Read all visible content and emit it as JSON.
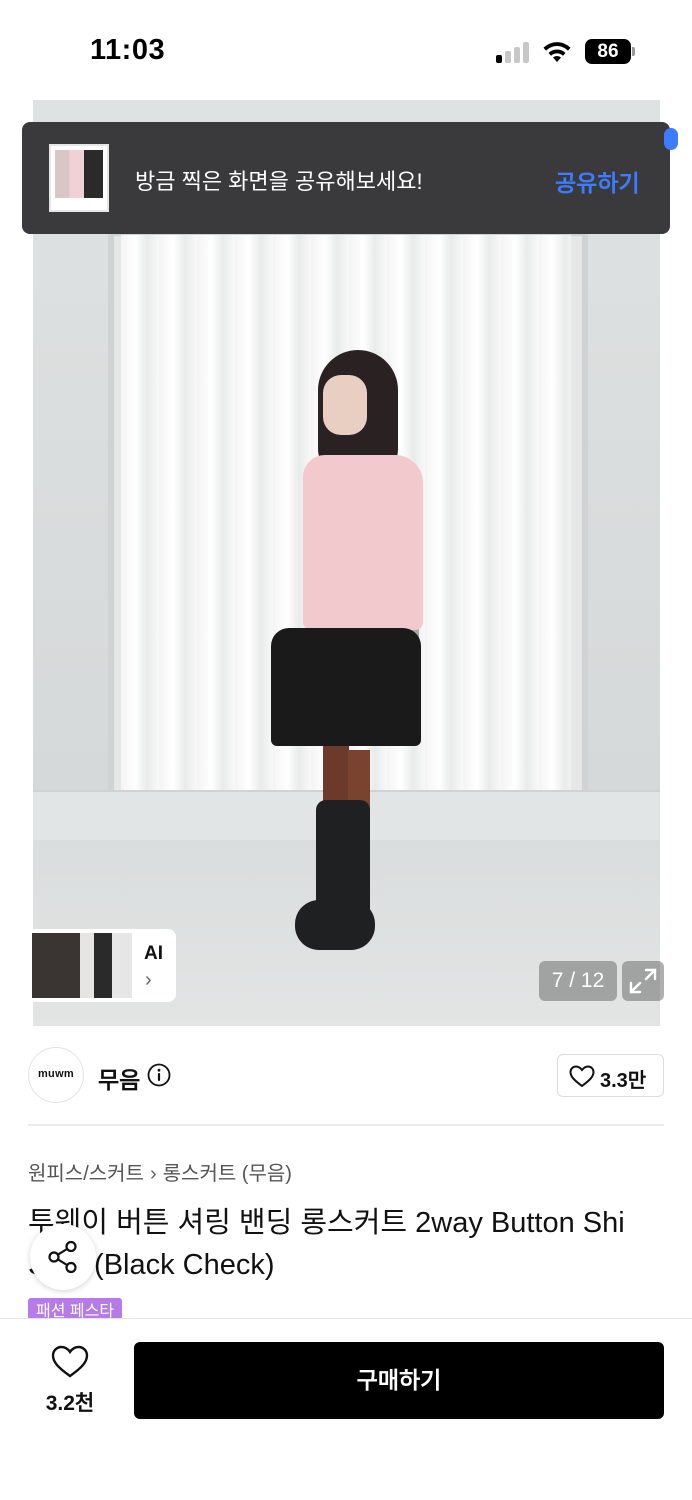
{
  "status_bar": {
    "time": "11:03",
    "battery": "86",
    "signal_bars_active": 1,
    "signal_bars_total": 4
  },
  "toast": {
    "message": "방금 찍은 화면을 공유해보세요!",
    "action_label": "공유하기",
    "action_color": "#3d7bff"
  },
  "gallery": {
    "page_indicator": "7 / 12",
    "current_page": 7,
    "total_pages": 12,
    "ai_label": "AI",
    "ai_chevron": "›",
    "expand_icon": "expand-icon"
  },
  "store": {
    "logo_text": "muwm",
    "name": "무음",
    "like_count": "3.3만"
  },
  "breadcrumb": {
    "category": "원피스/스커트",
    "separator": "›",
    "subcategory": "롱스커트 (무음)"
  },
  "product": {
    "title": "투웨이 버튼 셔링 밴딩 롱스커트 2way Button Shi\n     Skirt (Black Check)",
    "badge": "패션 페스타",
    "badge_color": "#b67be8"
  },
  "bottom_bar": {
    "wish_count": "3.2천",
    "buy_label": "구매하기"
  }
}
